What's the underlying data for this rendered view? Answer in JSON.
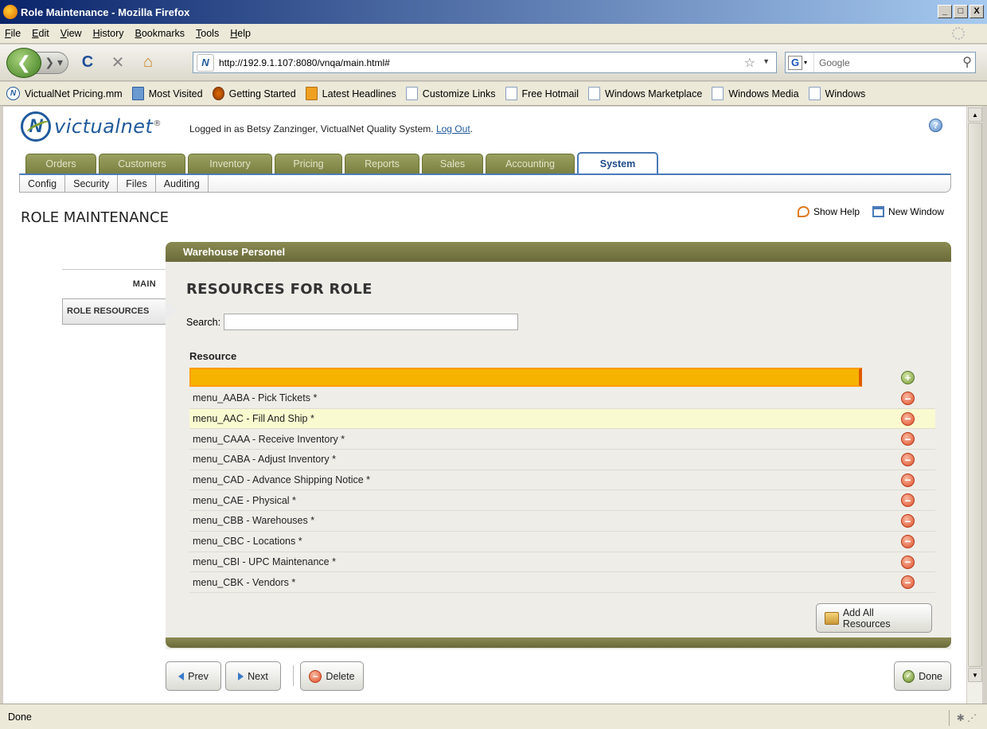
{
  "window": {
    "title": "Role Maintenance - Mozilla Firefox",
    "min": "_",
    "max": "□",
    "close": "X"
  },
  "menubar": [
    {
      "label": "File",
      "key": "F",
      "rest": "ile"
    },
    {
      "label": "Edit",
      "key": "E",
      "rest": "dit"
    },
    {
      "label": "View",
      "key": "V",
      "rest": "iew"
    },
    {
      "label": "History",
      "key": "H",
      "rest": "istory"
    },
    {
      "label": "Bookmarks",
      "key": "B",
      "rest": "ookmarks"
    },
    {
      "label": "Tools",
      "key": "T",
      "rest": "ools"
    },
    {
      "label": "Help",
      "key": "H",
      "rest": "elp"
    }
  ],
  "navbar": {
    "back_glyph": "❮",
    "fwd_glyph": "❯ ▾",
    "reload_glyph": "C",
    "stop_glyph": "✕",
    "home_glyph": "⌂",
    "site_glyph": "N",
    "url": "http://192.9.1.107:8080/vnqa/main.html#",
    "star_glyph": "☆",
    "drop_glyph": "▼",
    "search_engine_glyph": "G",
    "search_engine_drop": "▾",
    "search_placeholder": "Google",
    "search_go_glyph": "⚲"
  },
  "bookmarks": [
    {
      "label": "VictualNet Pricing.mm",
      "icon": "site"
    },
    {
      "label": "Most Visited",
      "icon": "mv"
    },
    {
      "label": "Getting Started",
      "icon": "gs"
    },
    {
      "label": "Latest Headlines",
      "icon": "rss"
    },
    {
      "label": "Customize Links",
      "icon": "page"
    },
    {
      "label": "Free Hotmail",
      "icon": "page"
    },
    {
      "label": "Windows Marketplace",
      "icon": "page"
    },
    {
      "label": "Windows Media",
      "icon": "page"
    },
    {
      "label": "Windows",
      "icon": "page"
    }
  ],
  "app": {
    "logo_mark": "N",
    "logo_text": "victualnet",
    "logo_reg": "®",
    "logged_in_text": "Logged in as Betsy Zanzinger, VictualNet Quality System.",
    "logout_label": "Log Out",
    "logout_suffix": ".",
    "help_glyph": "?"
  },
  "tabs": [
    {
      "label": "Orders",
      "active": false
    },
    {
      "label": "Customers",
      "active": false
    },
    {
      "label": "Inventory",
      "active": false
    },
    {
      "label": "Pricing",
      "active": false
    },
    {
      "label": "Reports",
      "active": false
    },
    {
      "label": "Sales",
      "active": false
    },
    {
      "label": "Accounting",
      "active": false
    },
    {
      "label": "System",
      "active": true
    }
  ],
  "subtabs": [
    "Config",
    "Security",
    "Files",
    "Auditing"
  ],
  "page": {
    "title": "ROLE MAINTENANCE",
    "show_help": "Show Help",
    "new_window": "New Window"
  },
  "leftnav": {
    "main": "MAIN",
    "role_resources": "ROLE RESOURCES"
  },
  "panel": {
    "header": "Warehouse Personel",
    "heading": "RESOURCES FOR ROLE",
    "search_label": "Search:",
    "search_value": "",
    "column_header": "Resource",
    "add_glyph": "+",
    "remove_glyph": "−",
    "add_all_label": "Add All Resources"
  },
  "resources": [
    {
      "label": "menu_AABA - Pick Tickets *",
      "highlighted": false
    },
    {
      "label": "menu_AAC - Fill And Ship *",
      "highlighted": true
    },
    {
      "label": "menu_CAAA - Receive Inventory *",
      "highlighted": false
    },
    {
      "label": "menu_CABA - Adjust Inventory *",
      "highlighted": false
    },
    {
      "label": "menu_CAD - Advance Shipping Notice *",
      "highlighted": false
    },
    {
      "label": "menu_CAE - Physical *",
      "highlighted": false
    },
    {
      "label": "menu_CBB - Warehouses *",
      "highlighted": false
    },
    {
      "label": "menu_CBC - Locations *",
      "highlighted": false
    },
    {
      "label": "menu_CBI - UPC Maintenance *",
      "highlighted": false
    },
    {
      "label": "menu_CBK - Vendors *",
      "highlighted": false
    }
  ],
  "buttons": {
    "prev": "Prev",
    "next": "Next",
    "delete": "Delete",
    "done": "Done",
    "delete_glyph": "−",
    "done_glyph": "✓"
  },
  "status": {
    "text": "Done"
  }
}
